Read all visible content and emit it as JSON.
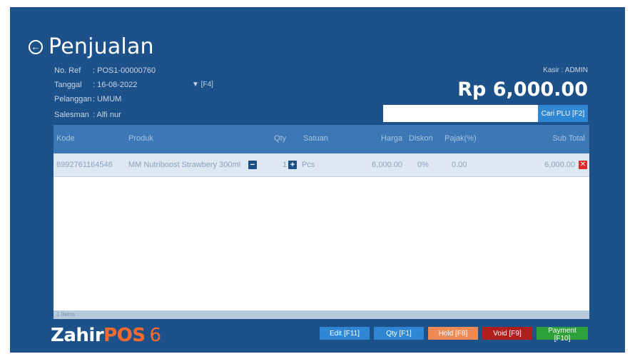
{
  "header": {
    "title": "Penjualan",
    "back_icon": "arrow-left-circle-icon"
  },
  "info": {
    "ref_label": "No. Ref",
    "ref_value": ": POS1-00000760",
    "date_label": "Tanggal",
    "date_value": ": 16-08-2022",
    "date_dropdown": "▼ [F4]",
    "customer_label": "Pelanggan",
    "customer_value": ": UMUM",
    "sales_label": "Salesman",
    "sales_value": ": Alfi nur"
  },
  "summary": {
    "cashier": "Kasir : ADMIN",
    "total": "Rp 6,000.00"
  },
  "search": {
    "value": "",
    "button_label": "Cari PLU [F2]"
  },
  "grid": {
    "columns": {
      "code": "Kode",
      "product": "Produk",
      "qty": "Qty",
      "unit": "Satuan",
      "price": "Harga",
      "discount": "Diskon",
      "tax": "Pajak(%)",
      "subtotal": "Sub Total"
    },
    "rows": [
      {
        "code": "8992761164546",
        "product": "MM Nutriboost Strawbery 300ml",
        "qty": "1",
        "unit": "Pcs",
        "price": "6,000.00",
        "discount": "0%",
        "tax": "0.00",
        "subtotal": "6,000.00"
      }
    ],
    "footer": "1 Items"
  },
  "brand": {
    "part1": "Zahir",
    "part2": "POS",
    "part3": "6"
  },
  "actions": {
    "edit": "Edit [F11]",
    "qty": "Qty [F1]",
    "hold": "Hold [F8]",
    "void": "Void [F9]",
    "payment": "Payment [F10]"
  },
  "colors": {
    "background": "#1d5189",
    "accent": "#2f86d2",
    "hold": "#f08a55",
    "void": "#b01e1e",
    "payment": "#2ea13a",
    "brand_orange": "#ff6a2a"
  }
}
